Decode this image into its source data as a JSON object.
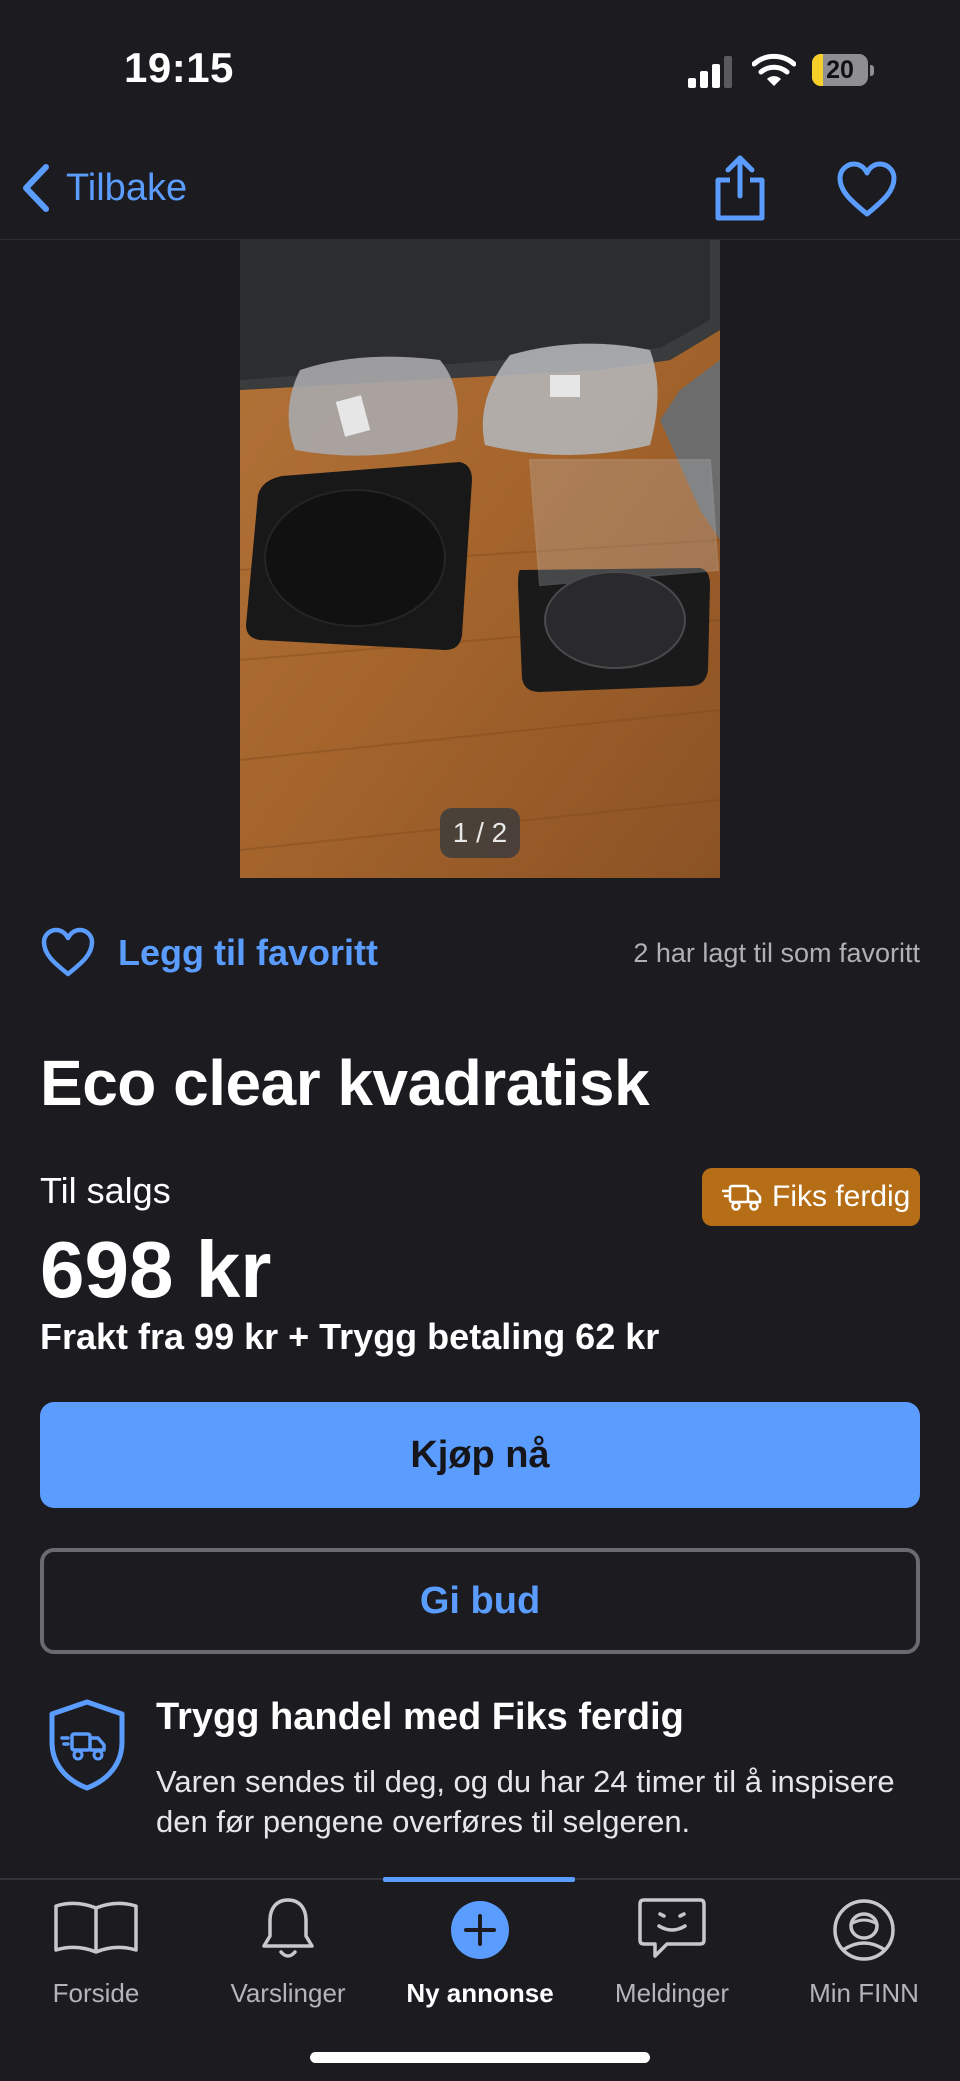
{
  "status_bar": {
    "time": "19:15",
    "battery": "20",
    "battery_level": 0.2
  },
  "nav": {
    "back_label": "Tilbake"
  },
  "gallery": {
    "pager": "1 / 2"
  },
  "favorite": {
    "label": "Legg til favoritt",
    "count_text": "2 har lagt til som favoritt"
  },
  "listing": {
    "title": "Eco clear kvadratisk",
    "status": "Til salgs",
    "badge": "Fiks ferdig",
    "price": "698 kr",
    "shipping": "Frakt fra 99 kr + Trygg betaling 62 kr"
  },
  "actions": {
    "buy_label": "Kjøp nå",
    "bid_label": "Gi bud"
  },
  "safe_trade": {
    "title": "Trygg handel med Fiks ferdig",
    "description": "Varen sendes til deg, og du har 24 timer til å inspisere den før pengene overføres til selgeren."
  },
  "tabs": [
    {
      "label": "Forside",
      "icon": "book-icon"
    },
    {
      "label": "Varslinger",
      "icon": "bell-icon"
    },
    {
      "label": "Ny annonse",
      "icon": "plus-circle-icon",
      "active": true
    },
    {
      "label": "Meldinger",
      "icon": "chat-icon"
    },
    {
      "label": "Min FINN",
      "icon": "profile-icon"
    }
  ],
  "colors": {
    "accent": "#5b9cff",
    "background": "#1c1b20",
    "badge": "#b56e16"
  }
}
